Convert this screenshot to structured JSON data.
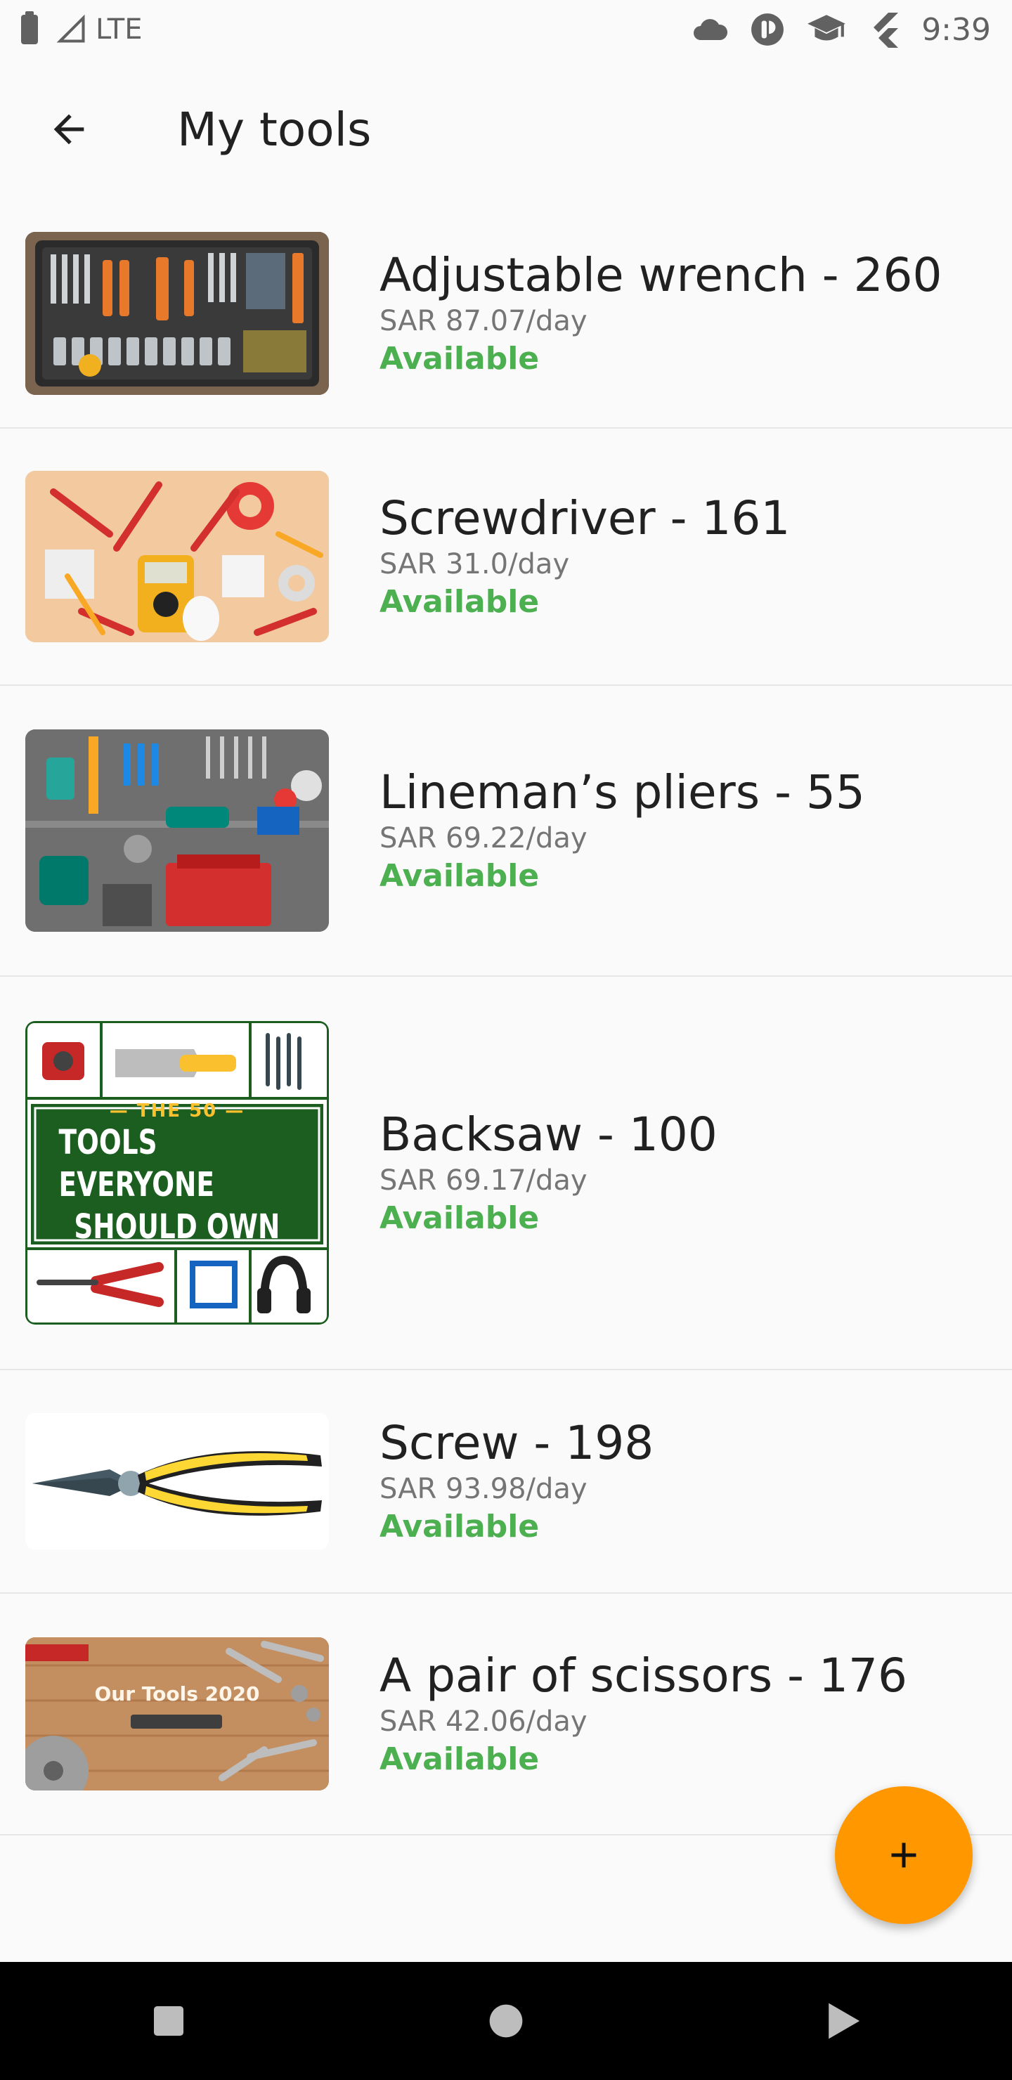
{
  "status_bar": {
    "network": "LTE",
    "time": "9:39",
    "icons_left": [
      "battery-icon",
      "signal-icon"
    ],
    "icons_right": [
      "cloud-icon",
      "app-notification-icon",
      "graduation-cap-icon",
      "flutter-icon"
    ]
  },
  "app_bar": {
    "title": "My tools",
    "back_icon": "arrow-back-icon"
  },
  "tools": [
    {
      "title": "Adjustable wrench - 260",
      "price": "SAR 87.07/day",
      "status": "Available",
      "image": "toolbox-case"
    },
    {
      "title": "Screwdriver - 161",
      "price": "SAR 31.0/day",
      "status": "Available",
      "image": "electrical-tools-flatlay"
    },
    {
      "title": "Lineman’s pliers - 55",
      "price": "SAR 69.22/day",
      "status": "Available",
      "image": "workshop-pegboard"
    },
    {
      "title": "Backsaw - 100",
      "price": "SAR 69.17/day",
      "status": "Available",
      "image": "tools-poster",
      "image_text": {
        "small": "— THE 50 —",
        "line1": "TOOLS EVERYONE",
        "line2": "SHOULD OWN"
      }
    },
    {
      "title": "Screw - 198",
      "price": "SAR 93.98/day",
      "status": "Available",
      "image": "pliers-photo"
    },
    {
      "title": "A pair of scissors - 176",
      "price": "SAR 42.06/day",
      "status": "Available",
      "image": "tools-banner",
      "image_text": {
        "caption": "Our Tools 2020"
      }
    }
  ],
  "fab": {
    "icon": "plus-icon",
    "action": "add-tool"
  },
  "nav_bar": {
    "icons": [
      "recent-apps-icon",
      "home-icon",
      "back-triangle-icon"
    ]
  },
  "colors": {
    "accent": "#ff9800",
    "available": "#4caf50",
    "background": "#fafafa",
    "divider": "#e6e6e6"
  }
}
